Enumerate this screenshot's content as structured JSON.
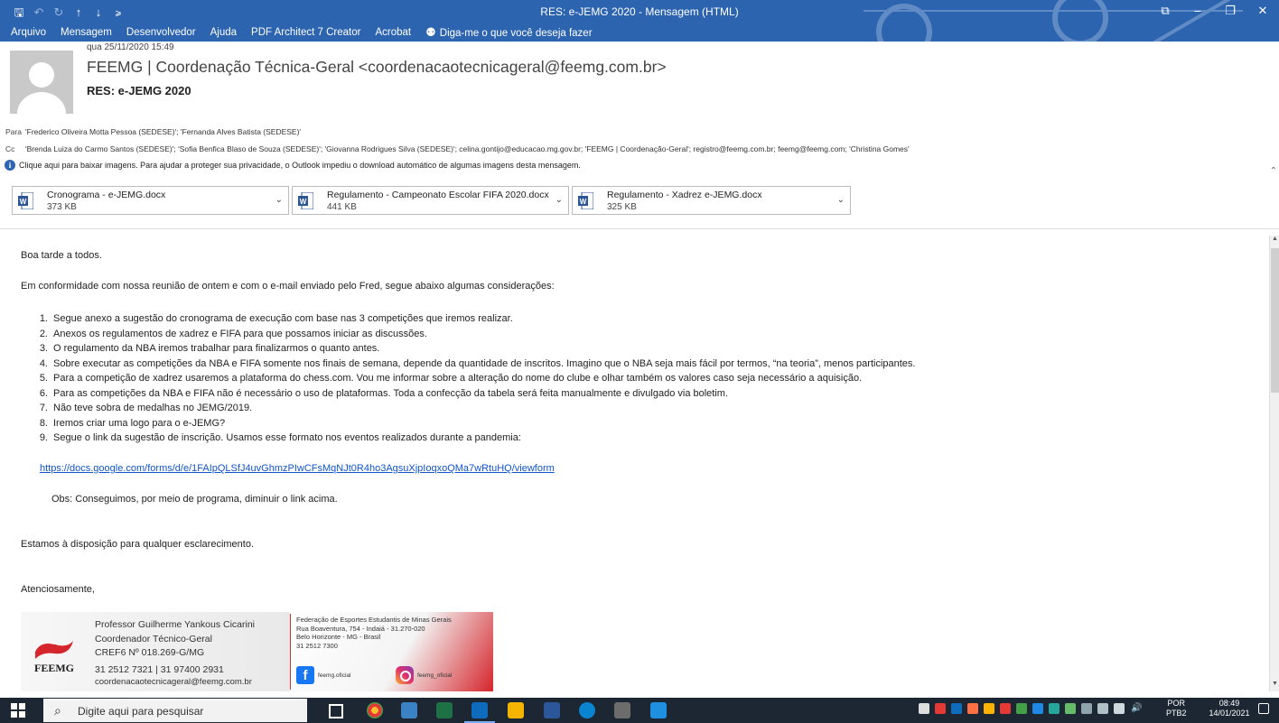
{
  "window": {
    "title": "RES: e-JEMG 2020  -  Mensagem (HTML)",
    "controls": [
      "ribbon-display-options",
      "minimize",
      "restore",
      "close"
    ],
    "accent": "#2c64b0"
  },
  "quick_access": {
    "icons": [
      "save-icon",
      "undo-icon",
      "redo-icon",
      "up-arrow-icon",
      "down-arrow-icon",
      "customize-icon"
    ]
  },
  "menu": {
    "items": [
      "Arquivo",
      "Mensagem",
      "Desenvolvedor",
      "Ajuda",
      "PDF Architect 7 Creator",
      "Acrobat"
    ],
    "tell_me": "Diga-me o que você deseja fazer"
  },
  "message": {
    "date": "qua 25/11/2020 15:49",
    "from": "FEEMG | Coordenação Técnica-Geral <coordenacaotecnicageral@feemg.com.br>",
    "subject": "RES: e-JEMG 2020",
    "to_label": "Para",
    "to": "'Frederico Oliveira Motta Pessoa (SEDESE)'; 'Fernanda Alves Batista (SEDESE)'",
    "cc_label": "Cc",
    "cc": "'Brenda Luiza do Carmo Santos (SEDESE)'; 'Sofia Benfica Blaso de Souza (SEDESE)'; 'Giovanna Rodrigues Silva (SEDESE)'; celina.gontijo@educacao.mg.gov.br; 'FEEMG | Coordenação-Geral'; registro@feemg.com.br; feemg@feemg.com; 'Christina Gomes'",
    "info_bar": "Clique aqui para baixar imagens. Para ajudar a proteger sua privacidade, o Outlook impediu o download automático de algumas imagens desta mensagem."
  },
  "attachments": [
    {
      "name": "Cronograma - e-JEMG.docx",
      "size": "373 KB"
    },
    {
      "name": "Regulamento - Campeonato Escolar FIFA 2020.docx",
      "size": "441 KB"
    },
    {
      "name": "Regulamento - Xadrez e-JEMG.docx",
      "size": "325 KB"
    }
  ],
  "body": {
    "greeting": "Boa tarde a todos.",
    "intro": "Em conformidade com nossa reunião de ontem e com o e-mail enviado pelo Fred, segue abaixo algumas considerações:",
    "items": [
      {
        "n": "1.",
        "text": "Segue anexo a sugestão do cronograma de execução com base nas 3 competições que iremos realizar."
      },
      {
        "n": "2.",
        "text": "Anexos os regulamentos de xadrez e FIFA para que possamos iniciar as discussões."
      },
      {
        "n": "3.",
        "text": "O regulamento da NBA iremos trabalhar para finalizarmos o quanto antes."
      },
      {
        "n": "4.",
        "text": "Sobre executar as competições da NBA e FIFA somente nos finais de semana, depende da quantidade de inscritos. Imagino que o NBA seja mais fácil por termos, “na teoria”, menos participantes."
      },
      {
        "n": "5.",
        "text": "Para a competição de xadrez usaremos a plataforma do chess.com. Vou me informar sobre a alteração do nome do clube e olhar também os valores caso seja necessário a aquisição."
      },
      {
        "n": "6.",
        "text": "Para as competições da NBA e FIFA não é necessário o uso de plataformas. Toda a confecção da tabela será feita manualmente e divulgado via boletim."
      },
      {
        "n": "7.",
        "text": "Não teve sobra de medalhas no JEMG/2019."
      },
      {
        "n": "8.",
        "text": "Iremos criar uma logo para o e-JEMG?"
      },
      {
        "n": "9.",
        "text": "Segue o link da sugestão de inscrição. Usamos esse formato nos eventos realizados durante a pandemia:"
      }
    ],
    "link": "https://docs.google.com/forms/d/e/1FAIpQLSfJ4uvGhmzPIwCFsMqNJt0R4ho3AgsuXjpIoqxoQMa7wRtuHQ/viewform",
    "obs": "Obs: Conseguimos, por meio de programa, diminuir o link acima.",
    "closing1": "Estamos à disposição para qualquer esclarecimento.",
    "closing2": "Atenciosamente,"
  },
  "signature": {
    "logo_text": "FEEMG",
    "name": "Professor Guilherme Yankous Cicarini",
    "role": "Coordenador Técnico-Geral",
    "cref": "CREF6 Nº 018.269-G/MG",
    "phones": "31 2512 7321 | 31 97400 2931",
    "email": "coordenacaotecnicageral@feemg.com.br",
    "org": "Federação de Esportes Estudantis de Minas Gerais",
    "address1": "Rua Boaventura, 754 - Indaiá - 31.270-020",
    "address2": "Belo Horizonte - MG - Brasil",
    "phone": "31 2512 7300",
    "facebook": "feemg.oficial",
    "instagram": "feemg_oficial",
    "accent": "#d4262c"
  },
  "taskbar": {
    "search_placeholder": "Digite aqui para pesquisar",
    "lang1": "POR",
    "lang2": "PTB2",
    "time": "08:49",
    "date": "14/01/2021"
  }
}
